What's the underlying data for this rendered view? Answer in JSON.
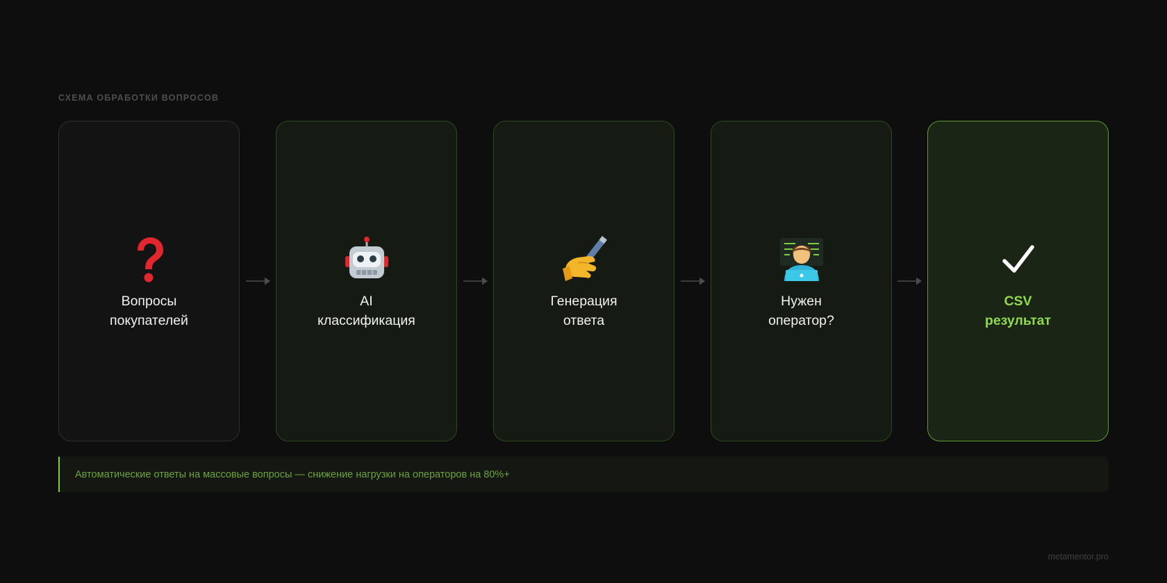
{
  "section_title": "СХЕМА ОБРАБОТКИ ВОПРОСОВ",
  "steps": [
    {
      "label": "Вопросы\nпокупателей",
      "icon": "question-mark-icon",
      "variant": "neutral"
    },
    {
      "label": "AI\nклассификация",
      "icon": "robot-icon",
      "variant": "active"
    },
    {
      "label": "Генерация\nответа",
      "icon": "writing-hand-icon",
      "variant": "active"
    },
    {
      "label": "Нужен\nоператор?",
      "icon": "technologist-icon",
      "variant": "active"
    },
    {
      "label": "CSV\nрезультат",
      "icon": "check-mark-icon",
      "variant": "result"
    }
  ],
  "note": "Автоматические ответы на массовые вопросы — снижение нагрузки на операторов на 80%+",
  "footer": "metamentor.pro",
  "colors": {
    "background": "#0d0e0d",
    "accent": "#7ed13b",
    "result_text": "#8fd94f",
    "card_border": "#2c4a1c"
  }
}
